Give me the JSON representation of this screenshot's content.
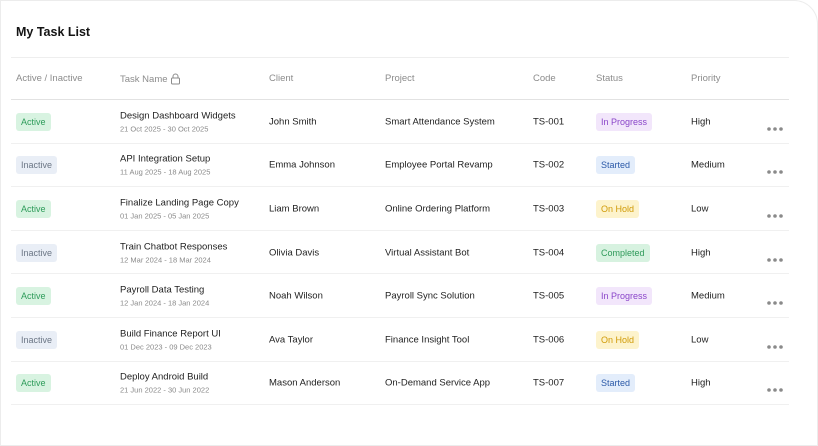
{
  "title": "My Task List",
  "columns": {
    "active": "Active / Inactive",
    "task": "Task Name",
    "client": "Client",
    "project": "Project",
    "code": "Code",
    "status": "Status",
    "priority": "Priority"
  },
  "rows": [
    {
      "state": "Active",
      "task": "Design Dashboard Widgets",
      "dates": "21 Oct 2025 - 30 Oct 2025",
      "client": "John Smith",
      "project": "Smart Attendance System",
      "code": "TS-001",
      "status": "In Progress",
      "priority": "High"
    },
    {
      "state": "Inactive",
      "task": "API Integration Setup",
      "dates": "11 Aug 2025 - 18 Aug 2025",
      "client": "Emma Johnson",
      "project": "Employee Portal Revamp",
      "code": "TS-002",
      "status": "Started",
      "priority": "Medium"
    },
    {
      "state": "Active",
      "task": "Finalize Landing Page Copy",
      "dates": "01 Jan 2025 - 05 Jan 2025",
      "client": "Liam Brown",
      "project": "Online Ordering Platform",
      "code": "TS-003",
      "status": "On Hold",
      "priority": "Low"
    },
    {
      "state": "Inactive",
      "task": "Train Chatbot Responses",
      "dates": "12 Mar 2024 - 18 Mar 2024",
      "client": "Olivia Davis",
      "project": "Virtual Assistant Bot",
      "code": "TS-004",
      "status": "Completed",
      "priority": "High"
    },
    {
      "state": "Active",
      "task": "Payroll Data Testing",
      "dates": "12 Jan 2024 - 18 Jan 2024",
      "client": "Noah Wilson",
      "project": "Payroll Sync Solution",
      "code": "TS-005",
      "status": "In Progress",
      "priority": "Medium"
    },
    {
      "state": "Inactive",
      "task": "Build Finance Report UI",
      "dates": "01 Dec 2023 - 09 Dec 2023",
      "client": "Ava Taylor",
      "project": "Finance Insight Tool",
      "code": "TS-006",
      "status": "On Hold",
      "priority": "Low"
    },
    {
      "state": "Active",
      "task": "Deploy Android Build",
      "dates": "21 Jun 2022 - 30 Jun 2022",
      "client": "Mason Anderson",
      "project": "On-Demand Service App",
      "code": "TS-007",
      "status": "Started",
      "priority": "High"
    }
  ],
  "icons": {
    "lock": "lock-icon",
    "more": "more-horizontal-icon"
  },
  "colors": {
    "active_bg": "#d8f3e1",
    "active_fg": "#2e9c5a",
    "inactive_bg": "#e9eef6",
    "inactive_fg": "#6b7685",
    "in_progress": "#8a45c9",
    "started": "#2c5aa8",
    "on_hold": "#d09a06",
    "completed": "#2f9a5a"
  }
}
